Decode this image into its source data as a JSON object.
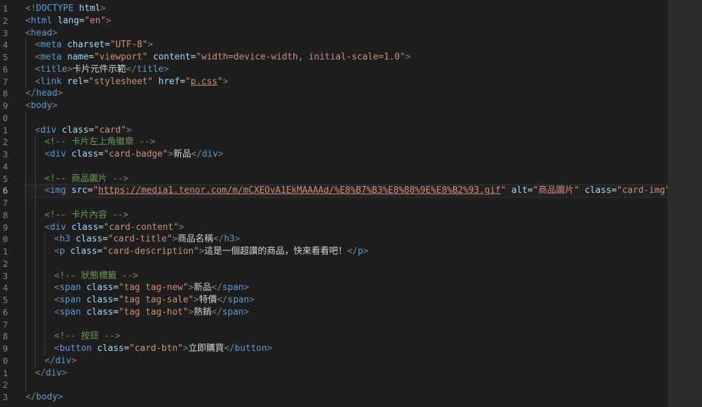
{
  "editor": {
    "line_numbers": [
      "1",
      "2",
      "3",
      "4",
      "5",
      "6",
      "7",
      "8",
      "9",
      "0",
      "1",
      "2",
      "3",
      "4",
      "5",
      "6",
      "7",
      "8",
      "9",
      "0",
      "1",
      "2",
      "3",
      "4",
      "5",
      "6",
      "7",
      "8",
      "9",
      "0",
      "1",
      "2",
      "3"
    ],
    "active_line_index": 15,
    "lines": [
      {
        "indent": 0,
        "tokens": [
          {
            "c": "t",
            "v": "<!"
          },
          {
            "c": "dt",
            "v": "DOCTYPE"
          },
          {
            "c": "tx",
            "v": " "
          },
          {
            "c": "an",
            "v": "html"
          },
          {
            "c": "t",
            "v": ">"
          }
        ]
      },
      {
        "indent": 0,
        "tokens": [
          {
            "c": "t",
            "v": "<"
          },
          {
            "c": "tn",
            "v": "html"
          },
          {
            "c": "tx",
            "v": " "
          },
          {
            "c": "an",
            "v": "lang"
          },
          {
            "c": "tx",
            "v": "="
          },
          {
            "c": "av",
            "v": "\"en\""
          },
          {
            "c": "t",
            "v": ">"
          }
        ]
      },
      {
        "indent": 0,
        "tokens": [
          {
            "c": "t",
            "v": "<"
          },
          {
            "c": "tn",
            "v": "head"
          },
          {
            "c": "t",
            "v": ">"
          }
        ]
      },
      {
        "indent": 1,
        "tokens": [
          {
            "c": "t",
            "v": "<"
          },
          {
            "c": "tn",
            "v": "meta"
          },
          {
            "c": "tx",
            "v": " "
          },
          {
            "c": "an",
            "v": "charset"
          },
          {
            "c": "tx",
            "v": "="
          },
          {
            "c": "av",
            "v": "\"UTF-8\""
          },
          {
            "c": "t",
            "v": ">"
          }
        ]
      },
      {
        "indent": 1,
        "tokens": [
          {
            "c": "t",
            "v": "<"
          },
          {
            "c": "tn",
            "v": "meta"
          },
          {
            "c": "tx",
            "v": " "
          },
          {
            "c": "an",
            "v": "name"
          },
          {
            "c": "tx",
            "v": "="
          },
          {
            "c": "av",
            "v": "\"viewport\""
          },
          {
            "c": "tx",
            "v": " "
          },
          {
            "c": "an",
            "v": "content"
          },
          {
            "c": "tx",
            "v": "="
          },
          {
            "c": "av",
            "v": "\"width=device-width, initial-scale=1.0\""
          },
          {
            "c": "t",
            "v": ">"
          }
        ]
      },
      {
        "indent": 1,
        "tokens": [
          {
            "c": "t",
            "v": "<"
          },
          {
            "c": "tn",
            "v": "title"
          },
          {
            "c": "t",
            "v": ">"
          },
          {
            "c": "tx",
            "v": "卡片元件示範"
          },
          {
            "c": "t",
            "v": "</"
          },
          {
            "c": "tn",
            "v": "title"
          },
          {
            "c": "t",
            "v": ">"
          }
        ]
      },
      {
        "indent": 1,
        "tokens": [
          {
            "c": "t",
            "v": "<"
          },
          {
            "c": "tn",
            "v": "link"
          },
          {
            "c": "tx",
            "v": " "
          },
          {
            "c": "an",
            "v": "rel"
          },
          {
            "c": "tx",
            "v": "="
          },
          {
            "c": "av",
            "v": "\"stylesheet\""
          },
          {
            "c": "tx",
            "v": " "
          },
          {
            "c": "an",
            "v": "href"
          },
          {
            "c": "tx",
            "v": "="
          },
          {
            "c": "av",
            "v": "\""
          },
          {
            "c": "av ul",
            "v": "p.css"
          },
          {
            "c": "av",
            "v": "\""
          },
          {
            "c": "t",
            "v": ">"
          }
        ]
      },
      {
        "indent": 0,
        "tokens": [
          {
            "c": "t",
            "v": "</"
          },
          {
            "c": "tn",
            "v": "head"
          },
          {
            "c": "t",
            "v": ">"
          }
        ]
      },
      {
        "indent": 0,
        "tokens": [
          {
            "c": "t",
            "v": "<"
          },
          {
            "c": "tn",
            "v": "body"
          },
          {
            "c": "t",
            "v": ">"
          }
        ]
      },
      {
        "indent": 0,
        "tokens": []
      },
      {
        "indent": 1,
        "tokens": [
          {
            "c": "t",
            "v": "<"
          },
          {
            "c": "tn",
            "v": "div"
          },
          {
            "c": "tx",
            "v": " "
          },
          {
            "c": "an",
            "v": "class"
          },
          {
            "c": "tx",
            "v": "="
          },
          {
            "c": "av",
            "v": "\"card\""
          },
          {
            "c": "t",
            "v": ">"
          }
        ]
      },
      {
        "indent": 2,
        "tokens": [
          {
            "c": "cm",
            "v": "<!-- 卡片左上角徽章 -->"
          }
        ]
      },
      {
        "indent": 2,
        "tokens": [
          {
            "c": "t",
            "v": "<"
          },
          {
            "c": "tn",
            "v": "div"
          },
          {
            "c": "tx",
            "v": " "
          },
          {
            "c": "an",
            "v": "class"
          },
          {
            "c": "tx",
            "v": "="
          },
          {
            "c": "av",
            "v": "\"card-badge\""
          },
          {
            "c": "t",
            "v": ">"
          },
          {
            "c": "tx",
            "v": "新品"
          },
          {
            "c": "t",
            "v": "</"
          },
          {
            "c": "tn",
            "v": "div"
          },
          {
            "c": "t",
            "v": ">"
          }
        ]
      },
      {
        "indent": 0,
        "tokens": []
      },
      {
        "indent": 2,
        "tokens": [
          {
            "c": "cm",
            "v": "<!-- 商品圖片 -->"
          }
        ]
      },
      {
        "indent": 2,
        "tokens": [
          {
            "c": "t",
            "v": "<"
          },
          {
            "c": "tn",
            "v": "img"
          },
          {
            "c": "tx",
            "v": " "
          },
          {
            "c": "an",
            "v": "src"
          },
          {
            "c": "tx",
            "v": "="
          },
          {
            "c": "av",
            "v": "\""
          },
          {
            "c": "av ul",
            "v": "https://media1.tenor.com/m/mCXEOvA1EkMAAAAd/%E8%B7%B3%E8%88%9E%E8%B2%93.gif"
          },
          {
            "c": "av",
            "v": "\""
          },
          {
            "c": "tx",
            "v": " "
          },
          {
            "c": "an",
            "v": "alt"
          },
          {
            "c": "tx",
            "v": "="
          },
          {
            "c": "av",
            "v": "\"商品圖片\""
          },
          {
            "c": "tx",
            "v": " "
          },
          {
            "c": "an",
            "v": "class"
          },
          {
            "c": "tx",
            "v": "="
          },
          {
            "c": "av",
            "v": "\"card-img\""
          },
          {
            "c": "t",
            "v": ">"
          }
        ]
      },
      {
        "indent": 0,
        "tokens": []
      },
      {
        "indent": 2,
        "tokens": [
          {
            "c": "cm",
            "v": "<!-- 卡片內容 -->"
          }
        ]
      },
      {
        "indent": 2,
        "tokens": [
          {
            "c": "t",
            "v": "<"
          },
          {
            "c": "tn",
            "v": "div"
          },
          {
            "c": "tx",
            "v": " "
          },
          {
            "c": "an",
            "v": "class"
          },
          {
            "c": "tx",
            "v": "="
          },
          {
            "c": "av",
            "v": "\"card-content\""
          },
          {
            "c": "t",
            "v": ">"
          }
        ]
      },
      {
        "indent": 3,
        "tokens": [
          {
            "c": "t",
            "v": "<"
          },
          {
            "c": "tn",
            "v": "h3"
          },
          {
            "c": "tx",
            "v": " "
          },
          {
            "c": "an",
            "v": "class"
          },
          {
            "c": "tx",
            "v": "="
          },
          {
            "c": "av",
            "v": "\"card-title\""
          },
          {
            "c": "t",
            "v": ">"
          },
          {
            "c": "tx",
            "v": "商品名稱"
          },
          {
            "c": "t",
            "v": "</"
          },
          {
            "c": "tn",
            "v": "h3"
          },
          {
            "c": "t",
            "v": ">"
          }
        ]
      },
      {
        "indent": 3,
        "tokens": [
          {
            "c": "t",
            "v": "<"
          },
          {
            "c": "tn",
            "v": "p"
          },
          {
            "c": "tx",
            "v": " "
          },
          {
            "c": "an",
            "v": "class"
          },
          {
            "c": "tx",
            "v": "="
          },
          {
            "c": "av",
            "v": "\"card-description\""
          },
          {
            "c": "t",
            "v": ">"
          },
          {
            "c": "tx",
            "v": "這是一個超讚的商品，快來看看吧！"
          },
          {
            "c": "t",
            "v": "</"
          },
          {
            "c": "tn",
            "v": "p"
          },
          {
            "c": "t",
            "v": ">"
          }
        ]
      },
      {
        "indent": 0,
        "tokens": []
      },
      {
        "indent": 3,
        "tokens": [
          {
            "c": "cm",
            "v": "<!-- 狀態標籤 -->"
          }
        ]
      },
      {
        "indent": 3,
        "tokens": [
          {
            "c": "t",
            "v": "<"
          },
          {
            "c": "tn",
            "v": "span"
          },
          {
            "c": "tx",
            "v": " "
          },
          {
            "c": "an",
            "v": "class"
          },
          {
            "c": "tx",
            "v": "="
          },
          {
            "c": "av",
            "v": "\"tag tag-new\""
          },
          {
            "c": "t",
            "v": ">"
          },
          {
            "c": "tx",
            "v": "新品"
          },
          {
            "c": "t",
            "v": "</"
          },
          {
            "c": "tn",
            "v": "span"
          },
          {
            "c": "t",
            "v": ">"
          }
        ]
      },
      {
        "indent": 3,
        "tokens": [
          {
            "c": "t",
            "v": "<"
          },
          {
            "c": "tn",
            "v": "span"
          },
          {
            "c": "tx",
            "v": " "
          },
          {
            "c": "an",
            "v": "class"
          },
          {
            "c": "tx",
            "v": "="
          },
          {
            "c": "av",
            "v": "\"tag tag-sale\""
          },
          {
            "c": "t",
            "v": ">"
          },
          {
            "c": "tx",
            "v": "特價"
          },
          {
            "c": "t",
            "v": "</"
          },
          {
            "c": "tn",
            "v": "span"
          },
          {
            "c": "t",
            "v": ">"
          }
        ]
      },
      {
        "indent": 3,
        "tokens": [
          {
            "c": "t",
            "v": "<"
          },
          {
            "c": "tn",
            "v": "span"
          },
          {
            "c": "tx",
            "v": " "
          },
          {
            "c": "an",
            "v": "class"
          },
          {
            "c": "tx",
            "v": "="
          },
          {
            "c": "av",
            "v": "\"tag tag-hot\""
          },
          {
            "c": "t",
            "v": ">"
          },
          {
            "c": "tx",
            "v": "熱銷"
          },
          {
            "c": "t",
            "v": "</"
          },
          {
            "c": "tn",
            "v": "span"
          },
          {
            "c": "t",
            "v": ">"
          }
        ]
      },
      {
        "indent": 0,
        "tokens": []
      },
      {
        "indent": 3,
        "tokens": [
          {
            "c": "cm",
            "v": "<!-- 按鈕 -->"
          }
        ]
      },
      {
        "indent": 3,
        "tokens": [
          {
            "c": "t",
            "v": "<"
          },
          {
            "c": "tn",
            "v": "button"
          },
          {
            "c": "tx",
            "v": " "
          },
          {
            "c": "an",
            "v": "class"
          },
          {
            "c": "tx",
            "v": "="
          },
          {
            "c": "av",
            "v": "\"card-btn\""
          },
          {
            "c": "t",
            "v": ">"
          },
          {
            "c": "tx",
            "v": "立即購買"
          },
          {
            "c": "t",
            "v": "</"
          },
          {
            "c": "tn",
            "v": "button"
          },
          {
            "c": "t",
            "v": ">"
          }
        ]
      },
      {
        "indent": 2,
        "tokens": [
          {
            "c": "t",
            "v": "</"
          },
          {
            "c": "tn",
            "v": "div"
          },
          {
            "c": "t",
            "v": ">"
          }
        ]
      },
      {
        "indent": 1,
        "tokens": [
          {
            "c": "t",
            "v": "</"
          },
          {
            "c": "tn",
            "v": "div"
          },
          {
            "c": "t",
            "v": ">"
          }
        ]
      },
      {
        "indent": 0,
        "tokens": []
      },
      {
        "indent": 0,
        "tokens": [
          {
            "c": "t",
            "v": "</"
          },
          {
            "c": "tn",
            "v": "body"
          },
          {
            "c": "t",
            "v": ">"
          }
        ]
      }
    ]
  },
  "colors": {
    "background": "#1e1e1e",
    "tag_bracket": "#808080",
    "tag_name": "#569cd6",
    "attr_name": "#9cdcfe",
    "attr_value": "#ce9178",
    "comment": "#6a9955",
    "text": "#d4d4d4",
    "line_number": "#858585"
  }
}
